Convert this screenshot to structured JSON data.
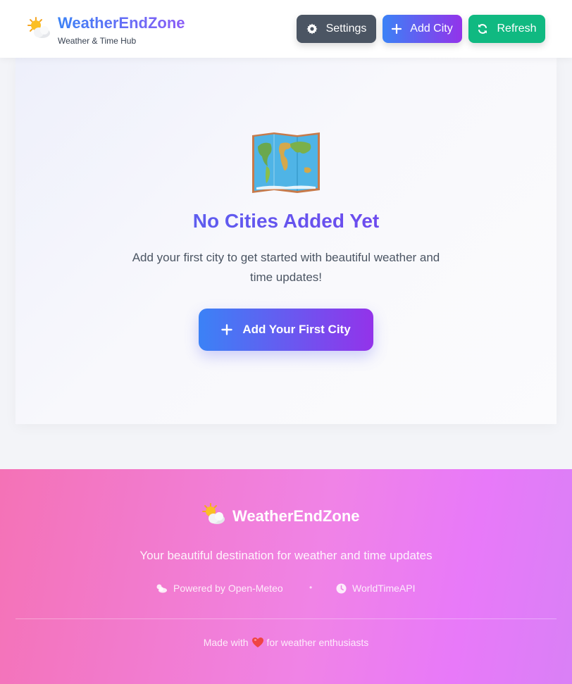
{
  "header": {
    "brand_title": "WeatherEndZone",
    "brand_subtitle": "Weather & Time Hub",
    "logo_icon": "sun-behind-cloud-icon",
    "buttons": {
      "settings": "Settings",
      "add_city": "Add City",
      "refresh": "Refresh"
    }
  },
  "empty_state": {
    "icon": "world-map-icon",
    "title": "No Cities Added Yet",
    "description": "Add your first city to get started with beautiful weather and time updates!",
    "cta_label": "Add Your First City"
  },
  "footer": {
    "brand_title": "WeatherEndZone",
    "tagline": "Your beautiful destination for weather and time updates",
    "powered_by": "Powered by Open-Meteo",
    "separator": "•",
    "time_api": "WorldTimeAPI",
    "made_with_prefix": "Made with",
    "made_with_suffix": "for weather enthusiasts"
  },
  "colors": {
    "accent_blue": "#3b82f6",
    "accent_purple": "#9333ea",
    "settings_gray": "#4b5563",
    "refresh_green": "#10b981",
    "footer_pink": "#f472b6"
  }
}
